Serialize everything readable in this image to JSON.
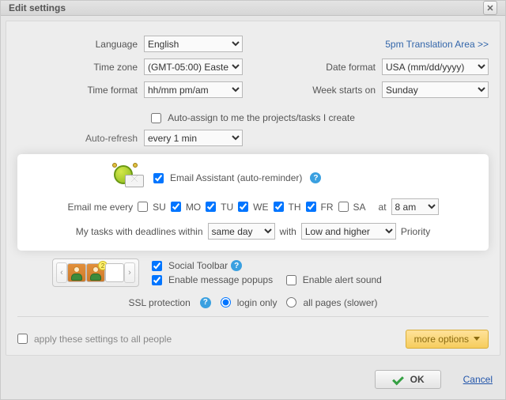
{
  "title": "Edit settings",
  "language": {
    "label": "Language",
    "value": "English"
  },
  "translation_link": "5pm Translation Area >>",
  "timezone": {
    "label": "Time zone",
    "value": "(GMT-05:00) Easte"
  },
  "dateformat": {
    "label": "Date format",
    "value": "USA (mm/dd/yyyy)"
  },
  "timeformat": {
    "label": "Time format",
    "value": "hh/mm pm/am"
  },
  "weekstarts": {
    "label": "Week starts on",
    "value": "Sunday"
  },
  "auto_assign": {
    "checked": false,
    "label": "Auto-assign to me the projects/tasks I create"
  },
  "auto_refresh": {
    "label": "Auto-refresh",
    "value": "every 1 min"
  },
  "email_assistant": {
    "checked": true,
    "label": "Email Assistant (auto-reminder)",
    "email_me_label": "Email me every",
    "days": [
      {
        "code": "SU",
        "checked": false
      },
      {
        "code": "MO",
        "checked": true
      },
      {
        "code": "TU",
        "checked": true
      },
      {
        "code": "WE",
        "checked": true
      },
      {
        "code": "TH",
        "checked": true
      },
      {
        "code": "FR",
        "checked": true
      },
      {
        "code": "SA",
        "checked": false
      }
    ],
    "at_label": "at",
    "at_time": "8 am",
    "deadline_prefix": "My tasks with deadlines within",
    "deadline_range": "same day",
    "with_label": "with",
    "priority_value": "Low and higher",
    "priority_label": "Priority"
  },
  "social": {
    "toolbar_label": "Social Toolbar",
    "toolbar_checked": true,
    "popups_label": "Enable message popups",
    "popups_checked": true,
    "sound_label": "Enable alert sound",
    "sound_checked": false,
    "badge": "2"
  },
  "ssl": {
    "label": "SSL protection",
    "login_only_label": "login only",
    "all_pages_label": "all pages (slower)",
    "selected": "login"
  },
  "apply_all": {
    "checked": false,
    "label": "apply these settings to all people"
  },
  "more_options_label": "more options",
  "ok_label": "OK",
  "cancel_label": "Cancel"
}
